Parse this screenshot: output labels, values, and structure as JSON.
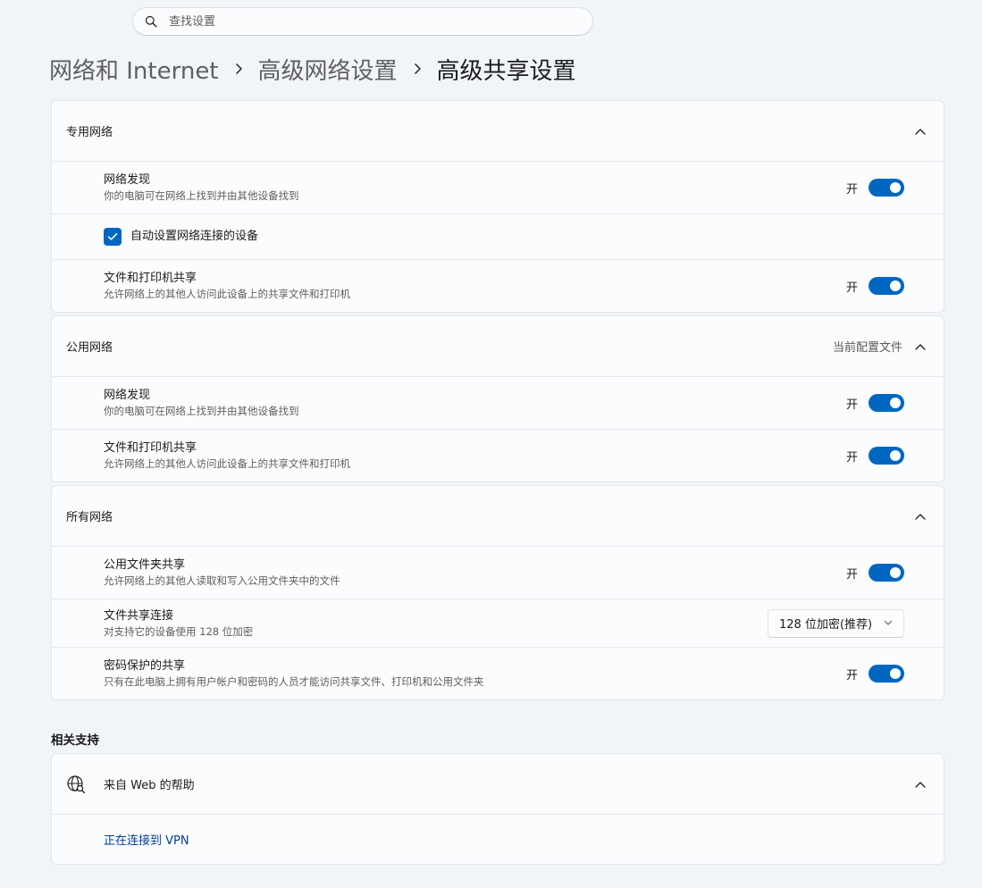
{
  "search": {
    "placeholder": "查找设置"
  },
  "breadcrumb": [
    "网络和 Internet",
    "高级网络设置",
    "高级共享设置"
  ],
  "private_network": {
    "title": "专用网络",
    "discovery": {
      "title": "网络发现",
      "desc": "你的电脑可在网络上找到并由其他设备找到",
      "state": "开"
    },
    "auto_setup": {
      "label": "自动设置网络连接的设备",
      "checked": true
    },
    "sharing": {
      "title": "文件和打印机共享",
      "desc": "允许网络上的其他人访问此设备上的共享文件和打印机",
      "state": "开"
    }
  },
  "public_network": {
    "title": "公用网络",
    "badge": "当前配置文件",
    "discovery": {
      "title": "网络发现",
      "desc": "你的电脑可在网络上找到并由其他设备找到",
      "state": "开"
    },
    "sharing": {
      "title": "文件和打印机共享",
      "desc": "允许网络上的其他人访问此设备上的共享文件和打印机",
      "state": "开"
    }
  },
  "all_networks": {
    "title": "所有网络",
    "public_folder": {
      "title": "公用文件夹共享",
      "desc": "允许网络上的其他人读取和写入公用文件夹中的文件",
      "state": "开"
    },
    "file_sharing": {
      "title": "文件共享连接",
      "desc": "对支持它的设备使用 128 位加密",
      "selected": "128 位加密(推荐)"
    },
    "password": {
      "title": "密码保护的共享",
      "desc": "只有在此电脑上拥有用户帐户和密码的人员才能访问共享文件、打印机和公用文件夹",
      "state": "开"
    }
  },
  "related": {
    "title": "相关支持",
    "help_title": "来自 Web 的帮助",
    "link": "正在连接到 VPN"
  },
  "colors": {
    "accent": "#0067c0",
    "link": "#003e92",
    "background": "#f1f4f9",
    "card": "#fbfcfe"
  }
}
